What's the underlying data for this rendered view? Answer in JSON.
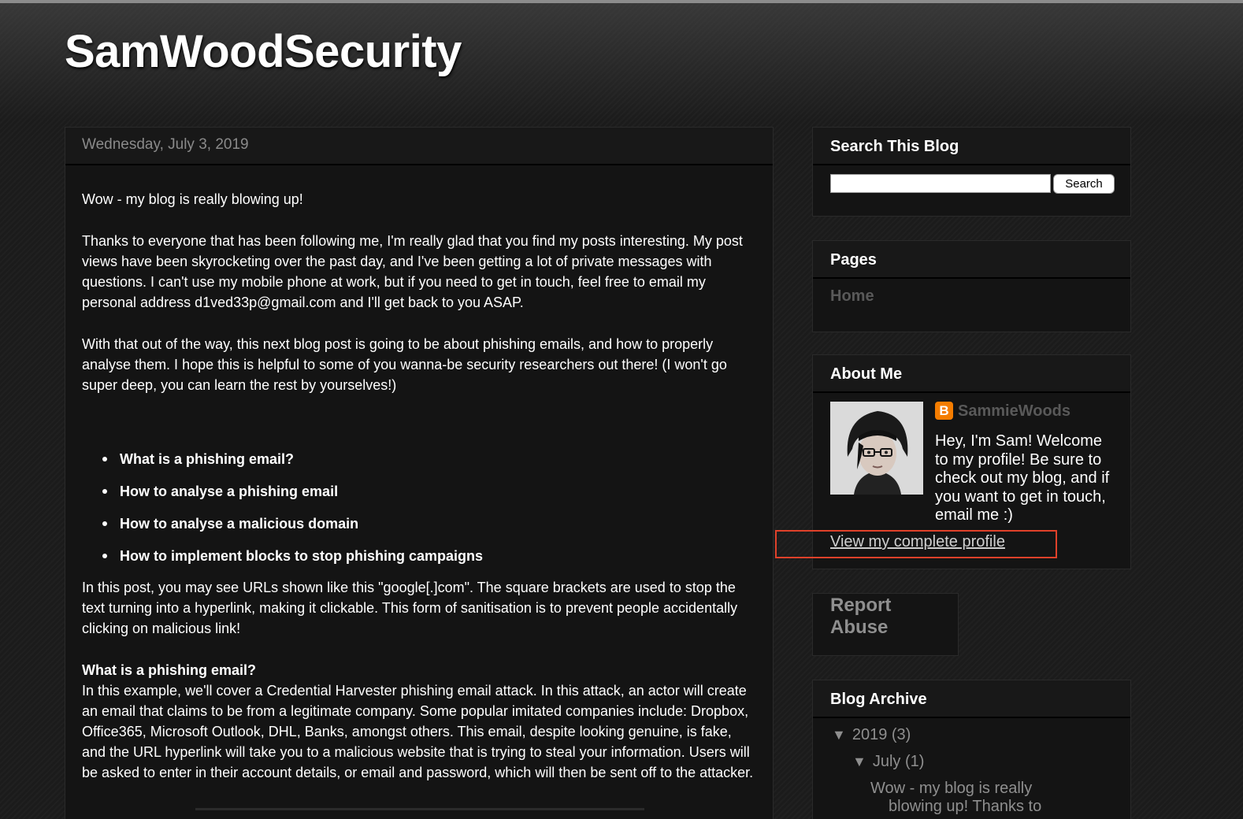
{
  "blog": {
    "title": "SamWoodSecurity"
  },
  "post": {
    "date": "Wednesday, July 3, 2019",
    "paragraph1": "Wow - my blog is really blowing up!",
    "paragraph2": "Thanks to everyone that has been following me, I'm really glad that you find my posts interesting. My post views have been skyrocketing over the past day, and I've been getting a lot of private messages with questions. I can't use my mobile phone at work, but if you need to get in touch, feel free to email my personal address d1ved33p@gmail.com and I'll get back to you ASAP.",
    "paragraph3": "With that out of the way, this next blog post is going to be about phishing emails, and how to properly analyse them. I hope this is helpful to some of you wanna-be security researchers out there! (I won't go super deep, you can learn the rest by yourselves!)",
    "bullets": [
      "What is a phishing email?",
      "How to analyse a phishing email",
      "How to analyse a malicious domain",
      "How to implement blocks to stop phishing campaigns"
    ],
    "paragraph4": "In this post, you may see URLs shown like this \"google[.]com\". The square brackets are used to stop the text turning into a hyperlink, making it clickable. This form of sanitisation is to prevent people accidentally clicking on malicious link!",
    "heading_phishing": "What is a phishing email?",
    "paragraph5": "In this example, we'll cover a Credential Harvester phishing email attack. In this attack, an actor will create an email that claims to be from a legitimate company. Some popular imitated companies include: Dropbox, Office365, Microsoft Outlook, DHL, Banks, amongst others. This email, despite looking genuine, is fake, and the URL hyperlink will take you to a malicious website that is trying to steal your information. Users will be asked to enter in their account details, or email and password, which will then be sent off to the attacker."
  },
  "sidebar": {
    "search": {
      "title": "Search This Blog",
      "input_value": "",
      "button_label": "Search"
    },
    "pages": {
      "title": "Pages",
      "items": [
        "Home"
      ]
    },
    "about": {
      "title": "About Me",
      "profile_icon": "blogger-icon",
      "name": "SammieWoods",
      "description": "Hey, I'm Sam! Welcome to my profile! Be sure to check out my blog, and if you want to get in touch, email me :)",
      "profile_link": "View my complete profile"
    },
    "report": {
      "label": "Report Abuse"
    },
    "archive": {
      "title": "Blog Archive",
      "year": "2019",
      "year_count": "(3)",
      "month": "July",
      "month_count": "(1)",
      "post_line1": "Wow - my blog is really",
      "post_line2": "blowing up! Thanks to"
    }
  },
  "colors": {
    "background": "#1b1b1b",
    "panel": "#141414",
    "highlight_box": "#e0412a",
    "blogger_orange": "#f57d00",
    "muted_link": "#8f8f8f"
  }
}
